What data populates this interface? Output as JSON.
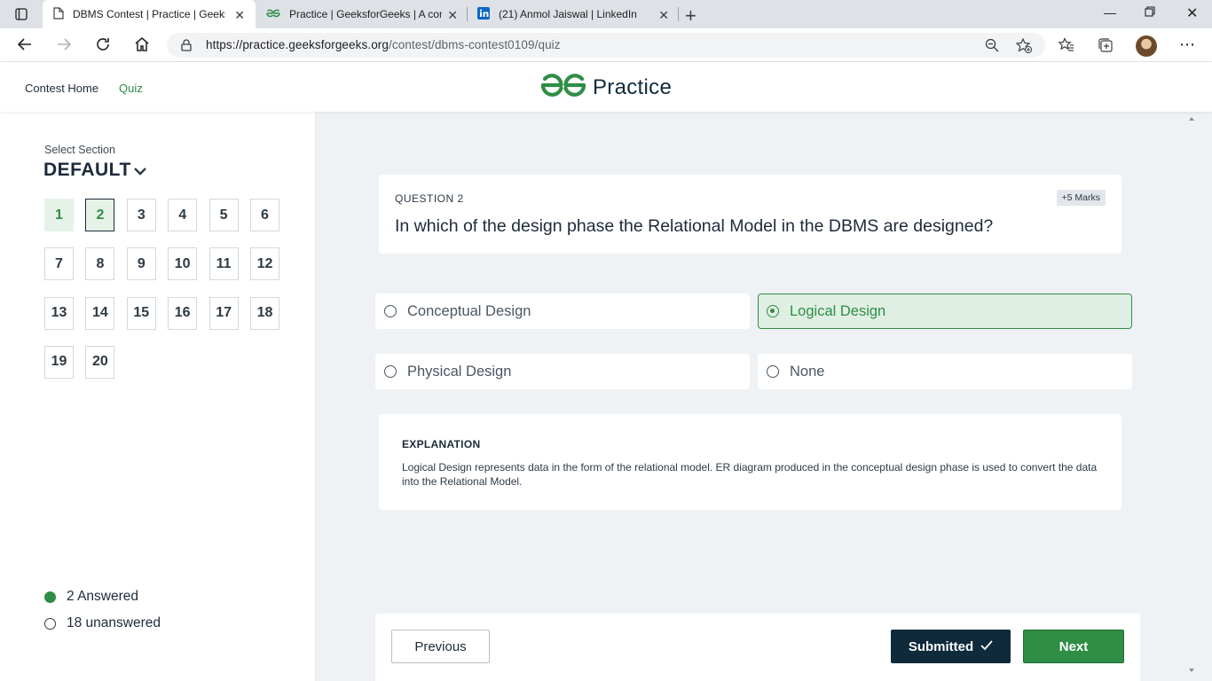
{
  "browser": {
    "tabs": [
      {
        "title": "DBMS Contest | Practice | GeeksforGeeks",
        "icon": "page-icon",
        "active": true
      },
      {
        "title": "Practice | GeeksforGeeks | A computer science portal for geeks",
        "icon": "gfg-icon",
        "active": false
      },
      {
        "title": "(21) Anmol Jaiswal | LinkedIn",
        "icon": "linkedin-icon",
        "active": false
      }
    ],
    "url_host": "https://practice.geeksforgeeks.org",
    "url_path": "/contest/dbms-contest0109/quiz"
  },
  "header": {
    "nav": {
      "home": "Contest Home",
      "quiz": "Quiz"
    },
    "brand": "Practice"
  },
  "sidebar": {
    "select_label": "Select Section",
    "section": "DEFAULT",
    "questions": [
      "1",
      "2",
      "3",
      "4",
      "5",
      "6",
      "7",
      "8",
      "9",
      "10",
      "11",
      "12",
      "13",
      "14",
      "15",
      "16",
      "17",
      "18",
      "19",
      "20"
    ],
    "answered_questions": [
      "1",
      "2"
    ],
    "current_question": "2",
    "answered_text": "2 Answered",
    "unanswered_text": "18 unanswered"
  },
  "question": {
    "number_label": "QUESTION 2",
    "marks": "+5 Marks",
    "text": "In which of the design phase the Relational Model in the DBMS are designed?",
    "options": [
      {
        "label": "Conceptual Design",
        "selected": false
      },
      {
        "label": "Logical Design",
        "selected": true
      },
      {
        "label": "Physical Design",
        "selected": false
      },
      {
        "label": "None",
        "selected": false
      }
    ]
  },
  "explanation": {
    "title": "EXPLANATION",
    "body": "Logical Design represents data in the form of the relational model. ER diagram produced in the conceptual design phase is used to convert the data into the Relational Model."
  },
  "footer": {
    "previous": "Previous",
    "submitted": "Submitted",
    "next": "Next"
  },
  "colors": {
    "brand_green": "#2f8d46",
    "navy": "#0f2a3a",
    "main_bg": "#eff2f5"
  }
}
